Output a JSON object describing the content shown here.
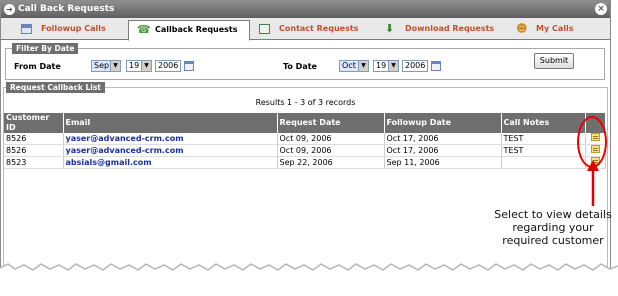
{
  "window": {
    "title": "Call Back Requests",
    "close_glyph": "×"
  },
  "tabs": [
    {
      "label": "Followup Calls",
      "icon": "calendar-icon"
    },
    {
      "label": "Callback Requests",
      "icon": "phone-icon",
      "active": true
    },
    {
      "label": "Contact Requests",
      "icon": "envelope-icon"
    },
    {
      "label": "Download Requests",
      "icon": "download-icon"
    },
    {
      "label": "My Calls",
      "icon": "user-icon"
    }
  ],
  "filter": {
    "legend": "Filter By Date",
    "from_label": "From Date",
    "from_month": "Sep",
    "from_day": "19",
    "from_year": "2006",
    "to_label": "To Date",
    "to_month": "Oct",
    "to_day": "19",
    "to_year": "2006",
    "submit_label": "Submit"
  },
  "list": {
    "legend": "Request Callback List",
    "results": "Results 1 - 3 of 3 records",
    "columns": [
      "Customer ID",
      "Email",
      "Request Date",
      "Followup Date",
      "Call Notes",
      ""
    ],
    "rows": [
      {
        "customer_id": "8526",
        "email": "yaser@advanced-crm.com",
        "request_date": "Oct 09, 2006",
        "followup_date": "Oct 17, 2006",
        "call_notes": "TEST"
      },
      {
        "customer_id": "8526",
        "email": "yaser@advanced-crm.com",
        "request_date": "Oct 09, 2006",
        "followup_date": "Oct 17, 2006",
        "call_notes": "TEST"
      },
      {
        "customer_id": "8523",
        "email": "absials@gmail.com",
        "request_date": "Sep 22, 2006",
        "followup_date": "Sep 11, 2006",
        "call_notes": ""
      }
    ]
  },
  "annotation": {
    "text": "Select to view details regarding your required customer",
    "color": "#e00000"
  }
}
